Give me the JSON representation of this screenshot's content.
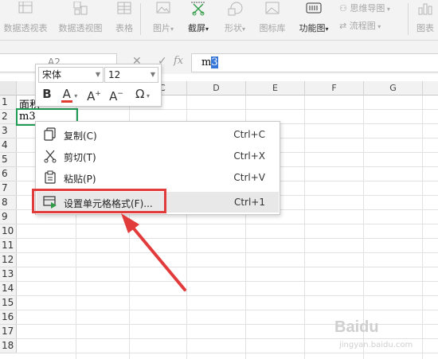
{
  "ribbon": {
    "items": [
      {
        "label": "数据透视表",
        "icon": "pivot-table-icon"
      },
      {
        "label": "数据透视图",
        "icon": "pivot-chart-icon"
      },
      {
        "label": "表格",
        "icon": "table-icon"
      },
      {
        "label": "图片",
        "icon": "picture-icon"
      },
      {
        "label": "截屏",
        "icon": "screenshot-icon"
      },
      {
        "label": "形状",
        "icon": "shape-icon"
      },
      {
        "label": "图标库",
        "icon": "icon-library-icon"
      },
      {
        "label": "功能图",
        "icon": "function-chart-icon"
      },
      {
        "label": "思维导图",
        "icon": "mind-map-icon"
      },
      {
        "label": "流程图",
        "icon": "flowchart-icon"
      },
      {
        "label": "图表",
        "icon": "chart-icon"
      }
    ]
  },
  "formula_bar": {
    "name_box": "A2",
    "fx": "fx",
    "content_prefix": "m",
    "content_selected": "3"
  },
  "columns": [
    "C",
    "D",
    "E",
    "F",
    "G"
  ],
  "rows": [
    "1",
    "2",
    "3",
    "4",
    "5",
    "6",
    "7",
    "8",
    "9",
    "10",
    "11",
    "12",
    "13",
    "14",
    "15",
    "16",
    "17",
    "18"
  ],
  "cells": {
    "a1": "面积",
    "a2_prefix": "m",
    "a2_selected": "3"
  },
  "mini_toolbar": {
    "font_name": "宋体",
    "font_size": "12",
    "bold": "B",
    "font_color": "A",
    "grow_font": "A",
    "shrink_font": "A",
    "symbol": "Ω"
  },
  "context_menu": {
    "items": [
      {
        "label": "复制(C)",
        "shortcut": "Ctrl+C",
        "icon": "copy-icon"
      },
      {
        "label": "剪切(T)",
        "shortcut": "Ctrl+X",
        "icon": "scissors-icon"
      },
      {
        "label": "粘贴(P)",
        "shortcut": "Ctrl+V",
        "icon": "paste-icon"
      },
      {
        "label": "设置单元格格式(F)...",
        "shortcut": "Ctrl+1",
        "icon": "format-cells-icon"
      }
    ]
  },
  "colors": {
    "highlight": "#e23b3b",
    "selection_border": "#1f9d55",
    "text_selection": "#3574d8",
    "font_color_underline": "#e03c31"
  },
  "watermark": {
    "brand": "Baidu",
    "sub": "jingyan.baidu.com"
  }
}
